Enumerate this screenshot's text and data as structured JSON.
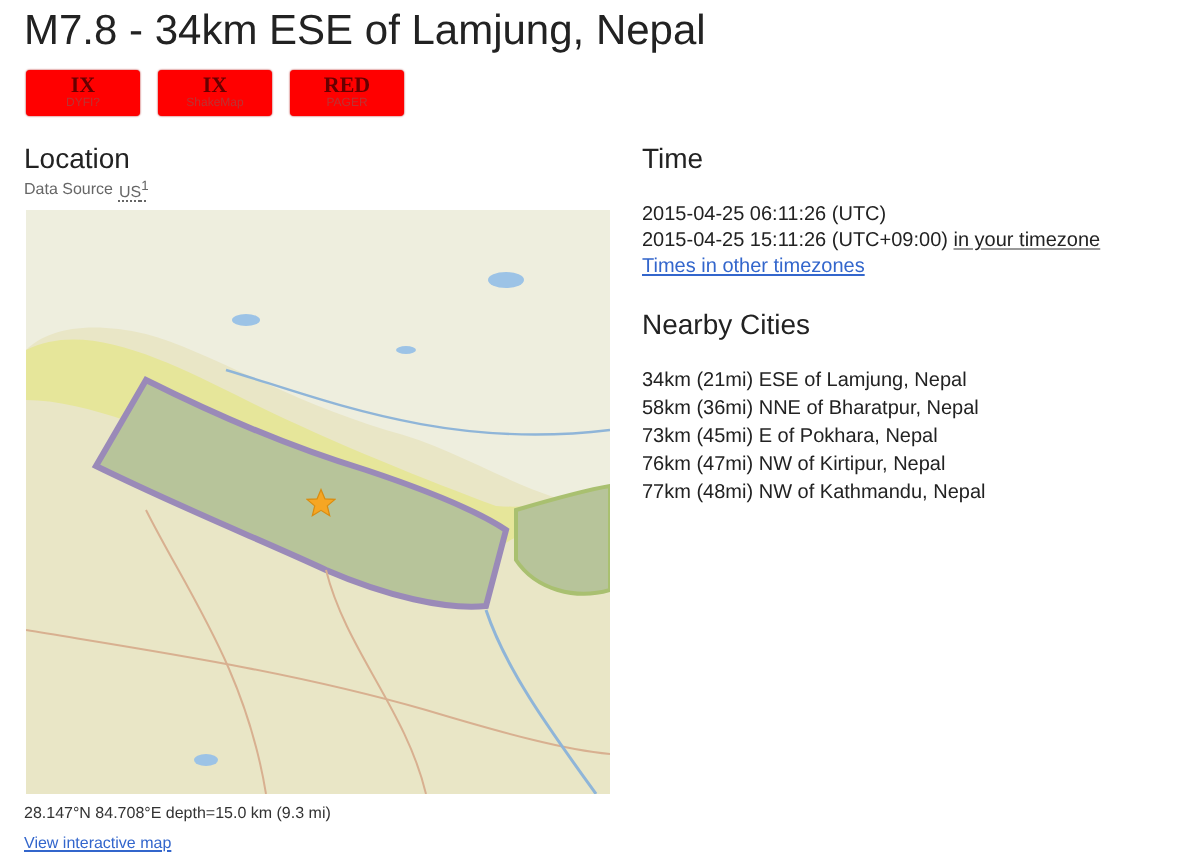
{
  "title": "M7.8 - 34km ESE of Lamjung, Nepal",
  "badges": [
    {
      "value": "IX",
      "label": "DYFI?"
    },
    {
      "value": "IX",
      "label": "ShakeMap"
    },
    {
      "value": "RED",
      "label": "PAGER"
    }
  ],
  "location": {
    "heading": "Location",
    "source_label": "Data Source",
    "source_value": "US$^{1}$",
    "coordinates": "28.147°N 84.708°E depth=15.0 km (9.3 mi)",
    "map_link": "View interactive map"
  },
  "time": {
    "heading": "Time",
    "utc": "2015-04-25 06:11:26 (UTC)",
    "local": "2015-04-25 15:11:26 (UTC+09:00)",
    "local_link": "in your timezone",
    "other_link": "Times in other timezones"
  },
  "nearby": {
    "heading": "Nearby Cities",
    "cities": [
      "34km (21mi) ESE of Lamjung, Nepal",
      "58km (36mi) NNE of Bharatpur, Nepal",
      "73km (45mi) E of Pokhara, Nepal",
      "76km (47mi) NW of Kirtipur, Nepal",
      "77km (48mi) NW of Kathmandu, Nepal"
    ]
  }
}
